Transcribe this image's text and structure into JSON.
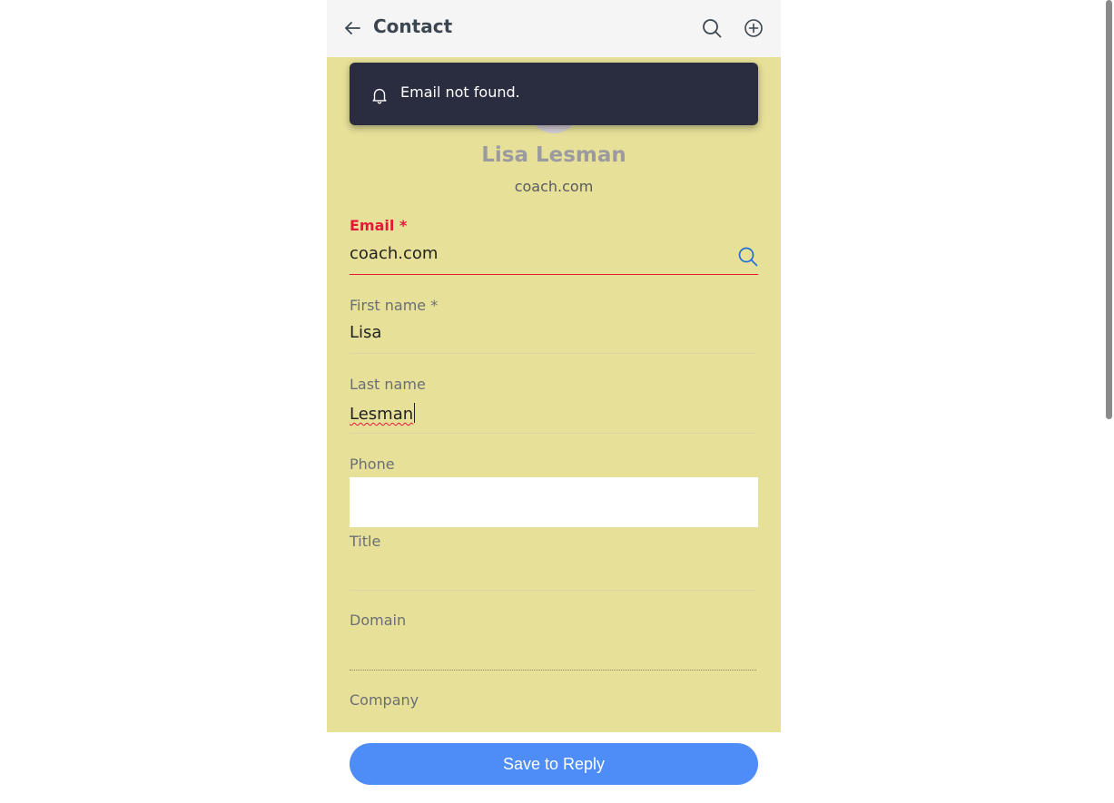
{
  "header": {
    "title": "Contact",
    "back_icon": "arrow-left-icon",
    "search_icon": "search-icon",
    "add_icon": "plus-circle-icon"
  },
  "toast": {
    "icon": "bell-icon",
    "message": "Email not found."
  },
  "contact": {
    "name": "Lisa Lesman",
    "subtitle": "coach.com"
  },
  "fields": {
    "email": {
      "label": "Email *",
      "value": "coach.com",
      "search_icon": "search-icon"
    },
    "first_name": {
      "label": "First name *",
      "value": "Lisa"
    },
    "last_name": {
      "label": "Last name",
      "value": "Lesman"
    },
    "phone": {
      "label": "Phone",
      "value": ""
    },
    "title": {
      "label": "Title",
      "value": ""
    },
    "domain": {
      "label": "Domain",
      "value": ""
    },
    "company": {
      "label": "Company",
      "value": ""
    }
  },
  "actions": {
    "save_label": "Save to Reply"
  },
  "colors": {
    "header_bg": "#f5f5f5",
    "content_bg": "#e7e098",
    "toast_bg": "#2a2d40",
    "required_red": "#e8173a",
    "accent_blue": "#4e8df7",
    "search_blue": "#1f6fd8"
  }
}
